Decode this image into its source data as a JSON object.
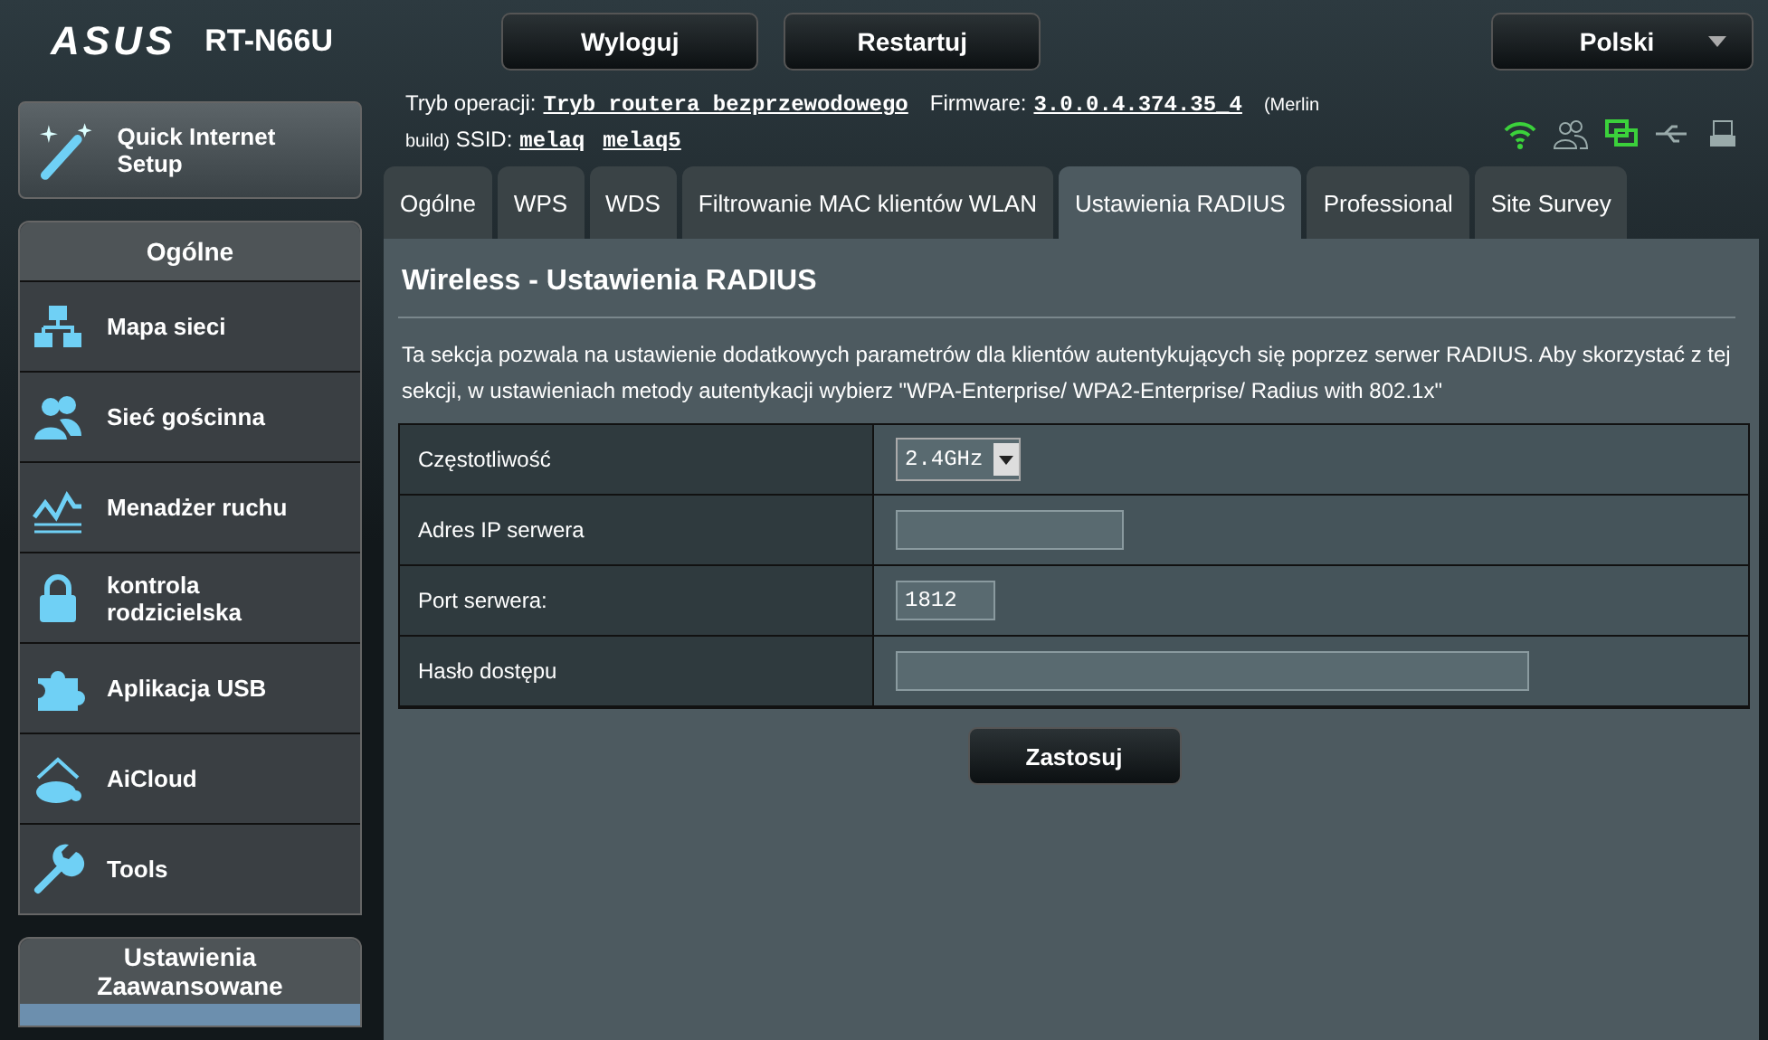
{
  "header": {
    "logo": "ASUS",
    "model": "RT-N66U",
    "buttons": [
      "Wyloguj",
      "Restartuj"
    ],
    "language": "Polski"
  },
  "info": {
    "mode_label": "Tryb operacji:",
    "mode": "Tryb routera bezprzewodowego",
    "firmware_label": "Firmware:",
    "firmware": "3.0.0.4.374.35_4",
    "firmware_note_1": "(Merlin",
    "firmware_note_2": "build)",
    "ssid_label": "SSID:",
    "ssids": [
      "melaq",
      "melaq5"
    ]
  },
  "status_icons": [
    {
      "kind": "wifi",
      "active": true
    },
    {
      "kind": "clients",
      "active": false
    },
    {
      "kind": "network",
      "active": true
    },
    {
      "kind": "usb",
      "active": false
    },
    {
      "kind": "printer",
      "active": false
    }
  ],
  "quick_setup": "Quick Internet Setup",
  "sidebar": {
    "general_title": "Ogólne",
    "items": [
      {
        "label": "Mapa sieci",
        "kind": "map"
      },
      {
        "label": "Sieć gościnna",
        "kind": "guests"
      },
      {
        "label": "Menadżer ruchu",
        "kind": "traffic"
      },
      {
        "label": "kontrola rodzicielska",
        "kind": "lock"
      },
      {
        "label": "Aplikacja USB",
        "kind": "puzzle"
      },
      {
        "label": "AiCloud",
        "kind": "cloud"
      },
      {
        "label": "Tools",
        "kind": "wrench"
      }
    ],
    "advanced_title": "Ustawienia Zaawansowane"
  },
  "tabs": [
    {
      "label": "Ogólne",
      "selected": false
    },
    {
      "label": "WPS",
      "selected": false
    },
    {
      "label": "WDS",
      "selected": false
    },
    {
      "label": "Filtrowanie MAC klientów WLAN",
      "selected": false
    },
    {
      "label": "Ustawienia RADIUS",
      "selected": true
    },
    {
      "label": "Professional",
      "selected": false
    },
    {
      "label": "Site Survey",
      "selected": false
    }
  ],
  "page": {
    "title": "Wireless - Ustawienia RADIUS",
    "description": "Ta sekcja pozwala na ustawienie dodatkowych parametrów dla klientów autentykujących się poprzez serwer RADIUS. Aby skorzystać z tej sekcji, w ustawieniach metody autentykacji wybierz \"WPA-Enterprise/ WPA2-Enterprise/ Radius with 802.1x\"",
    "fields": [
      {
        "label": "Częstotliwość",
        "kind": "select",
        "value": "2.4GHz"
      },
      {
        "label": "Adres IP serwera",
        "kind": "address"
      },
      {
        "label": "Port serwera:",
        "kind": "port",
        "value": "1812"
      },
      {
        "label": "Hasło dostępu",
        "kind": "password"
      }
    ],
    "apply": "Zastosuj"
  }
}
